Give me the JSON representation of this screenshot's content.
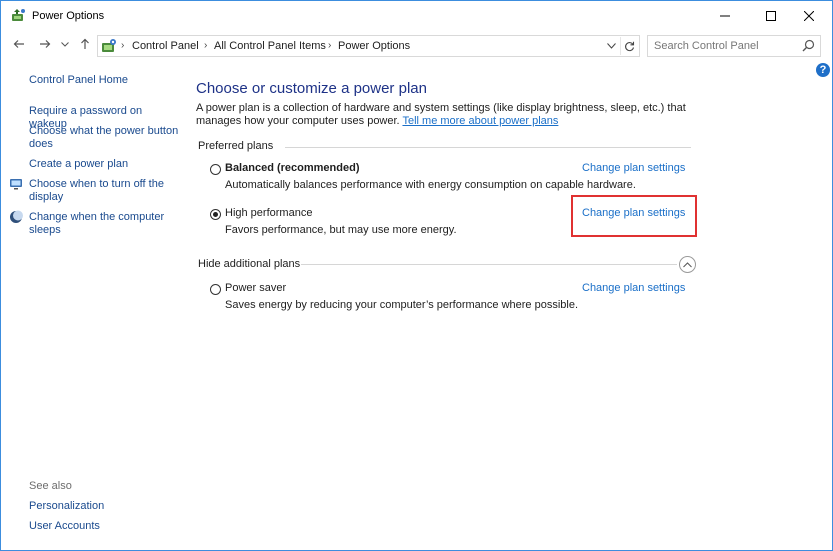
{
  "window": {
    "title": "Power Options",
    "icon": "power-options-icon",
    "controls": [
      "minimize-icon",
      "maximize-icon",
      "close-icon"
    ]
  },
  "address": {
    "breadcrumb": [
      "Control Panel",
      "All Control Panel Items",
      "Power Options"
    ],
    "search_placeholder": "Search Control Panel"
  },
  "sidebar": {
    "home": "Control Panel Home",
    "items": [
      {
        "label": "Require a password on wakeup",
        "icon": ""
      },
      {
        "label": "Choose what the power button does",
        "icon": ""
      },
      {
        "label": "Create a power plan",
        "icon": ""
      },
      {
        "label": "Choose when to turn off the display",
        "icon": "monitor-icon"
      },
      {
        "label": "Change when the computer sleeps",
        "icon": "moon-icon"
      }
    ],
    "see_also": {
      "heading": "See also",
      "items": [
        "Personalization",
        "User Accounts"
      ]
    }
  },
  "main": {
    "title": "Choose or customize a power plan",
    "intro_text": "A power plan is a collection of hardware and system settings (like display brightness, sleep, etc.) that manages how your computer uses power.",
    "intro_link": "Tell me more about power plans",
    "preferred_heading": "Preferred plans",
    "hidden_heading": "Hide additional plans",
    "plans": [
      {
        "name": "Balanced (recommended)",
        "description": "Automatically balances performance with energy consumption on capable hardware.",
        "link": "Change plan settings",
        "selected": false
      },
      {
        "name": "High performance",
        "description": "Favors performance, but may use more energy.",
        "link": "Change plan settings",
        "selected": true
      },
      {
        "name": "Power saver",
        "description": "Saves energy by reducing your computer’s performance where possible.",
        "link": "Change plan settings",
        "selected": false
      }
    ]
  },
  "help": "?",
  "colors": {
    "link": "#1a6fc8",
    "title": "#1e3287",
    "highlight": "#e03131",
    "window_border": "#3c8dde"
  }
}
